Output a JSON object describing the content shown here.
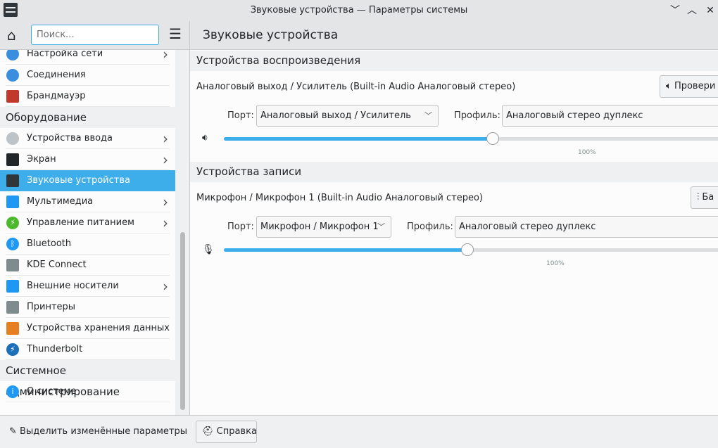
{
  "window": {
    "title": "Звуковые устройства — Параметры системы",
    "minimize": "﹀",
    "maximize": "︿",
    "close": "✕"
  },
  "toolbar": {
    "search_placeholder": "Поиск...",
    "page_title": "Звуковые устройства"
  },
  "sidebar": {
    "items": [
      {
        "label": "Настройка сети",
        "chevron": true,
        "icon": "globe-icon",
        "color": "#3a8ee0"
      },
      {
        "label": "Соединения",
        "chevron": false,
        "icon": "globe-icon",
        "color": "#3a8ee0"
      },
      {
        "label": "Брандмауэр",
        "chevron": false,
        "icon": "firewall-icon",
        "color": "#c0392b"
      },
      {
        "category": "Оборудование"
      },
      {
        "label": "Устройства ввода",
        "chevron": true,
        "icon": "mouse-icon",
        "color": "#bdc3c7"
      },
      {
        "label": "Экран",
        "chevron": true,
        "icon": "monitor-icon",
        "color": "#232629"
      },
      {
        "label": "Звуковые устройства",
        "chevron": false,
        "icon": "speaker-icon",
        "color": "#31363b",
        "selected": true
      },
      {
        "label": "Мультимедиа",
        "chevron": true,
        "icon": "multimedia-icon",
        "color": "#1d99f3"
      },
      {
        "label": "Управление питанием",
        "chevron": true,
        "icon": "power-icon",
        "color": "#4cb82d"
      },
      {
        "label": "Bluetooth",
        "chevron": false,
        "icon": "bluetooth-icon",
        "color": "#1d99f3"
      },
      {
        "label": "KDE Connect",
        "chevron": false,
        "icon": "phone-icon",
        "color": "#7f8c8d"
      },
      {
        "label": "Внешние носители",
        "chevron": true,
        "icon": "usb-icon",
        "color": "#1d99f3"
      },
      {
        "label": "Принтеры",
        "chevron": false,
        "icon": "printer-icon",
        "color": "#7f8c8d"
      },
      {
        "label": "Устройства хранения данных",
        "chevron": false,
        "icon": "storage-icon",
        "color": "#e67e22"
      },
      {
        "label": "Thunderbolt",
        "chevron": false,
        "icon": "thunderbolt-icon",
        "color": "#1d6fb8"
      },
      {
        "category": "Системное администрирование"
      },
      {
        "label": "О системе",
        "chevron": false,
        "icon": "info-icon",
        "color": "#1d99f3"
      }
    ]
  },
  "playback": {
    "heading": "Устройства воспроизведения",
    "device": "Аналоговый выход / Усилитель (Built-in Audio Аналоговый стерео)",
    "test_button": "Провери",
    "port_label": "Порт:",
    "port_value": "Аналоговый выход / Усилитель",
    "profile_label": "Профиль:",
    "profile_value": "Аналоговый стерео дуплекс",
    "volume_percent": 100,
    "volume_position_fraction": 0.53,
    "volume_text": "100%"
  },
  "recording": {
    "heading": "Устройства записи",
    "device": "Микрофон / Микрофон 1 (Built-in Audio Аналоговый стерео)",
    "config_button": "Ба",
    "port_label": "Порт:",
    "port_value": "Микрофон / Микрофон 1",
    "profile_label": "Профиль:",
    "profile_value": "Аналоговый стерео дуплекс",
    "volume_percent": 100,
    "volume_position_fraction": 0.48,
    "volume_text": "100%"
  },
  "footer": {
    "highlight_changes": "Выделить изменённые параметры",
    "help": "Справка"
  },
  "accent": "#3daee9"
}
